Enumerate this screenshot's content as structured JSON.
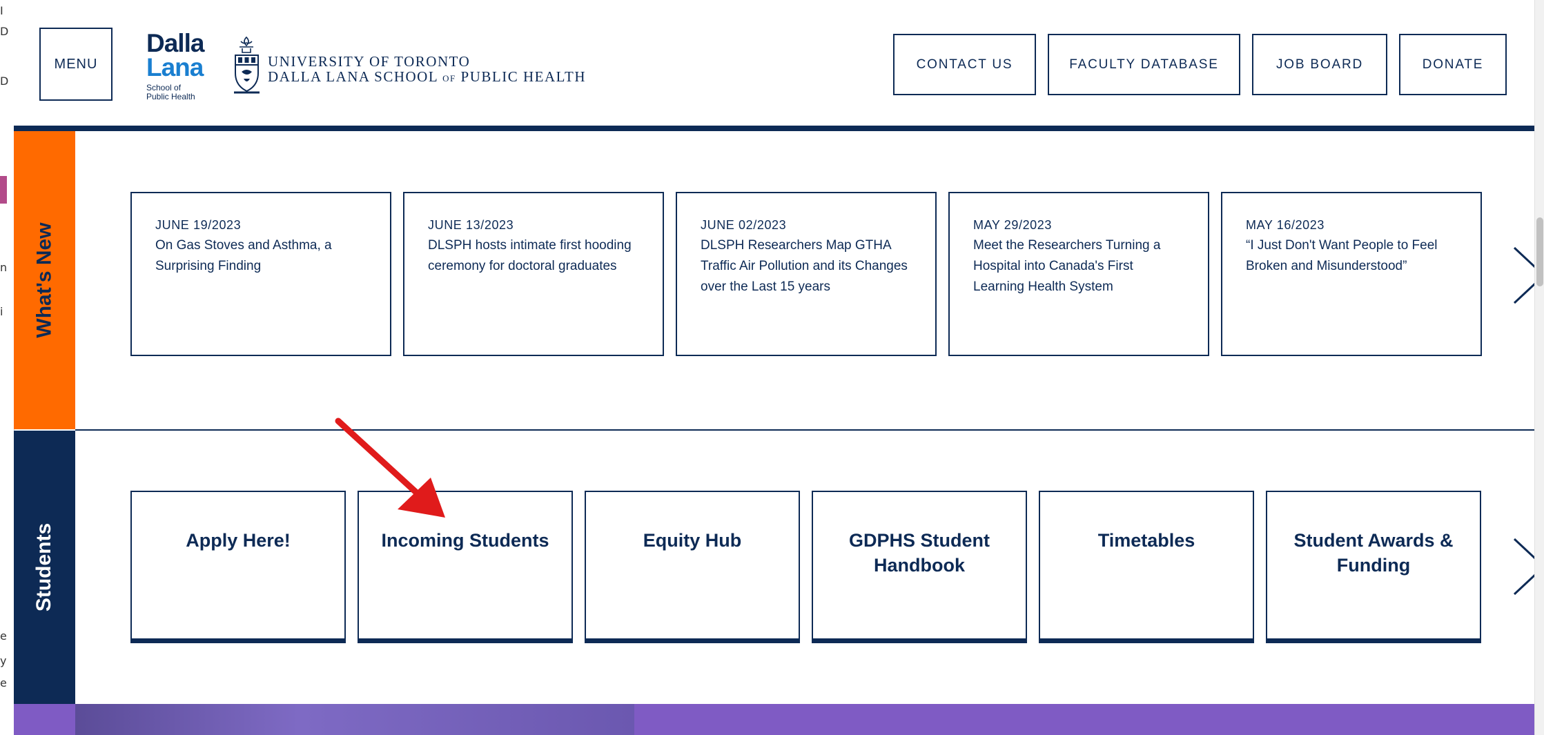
{
  "header": {
    "menu_label": "MENU",
    "logo": {
      "line1": "Dalla",
      "line2": "Lana",
      "line3": "School of",
      "line4": "Public Health"
    },
    "university": {
      "line1": "UNIVERSITY OF TORONTO",
      "line2_part1": "DALLA LANA SCHOOL ",
      "line2_of": "OF",
      "line2_part2": " PUBLIC HEALTH"
    },
    "buttons": [
      {
        "label": "CONTACT US"
      },
      {
        "label": "FACULTY DATABASE"
      },
      {
        "label": "JOB BOARD"
      },
      {
        "label": "DONATE"
      }
    ]
  },
  "sections": {
    "whats_new": {
      "tab_label": "What's New",
      "cards": [
        {
          "date": "JUNE 19/2023",
          "title": "On Gas Stoves and Asthma, a Surprising Finding"
        },
        {
          "date": "JUNE 13/2023",
          "title": "DLSPH hosts intimate first hooding ceremony for doctoral graduates"
        },
        {
          "date": "JUNE 02/2023",
          "title": "DLSPH Researchers Map GTHA Traffic Air Pollution and its Changes over the Last 15 years"
        },
        {
          "date": "MAY 29/2023",
          "title": "Meet the Researchers Turning a Hospital into Canada's First Learning Health System"
        },
        {
          "date": "MAY 16/2023",
          "title": "“I Just Don't Want People to Feel Broken and Misunderstood”"
        }
      ]
    },
    "students": {
      "tab_label": "Students",
      "cards": [
        {
          "label": "Apply Here!"
        },
        {
          "label": "Incoming Students"
        },
        {
          "label": "Equity Hub"
        },
        {
          "label": "GDPHS Student Handbook"
        },
        {
          "label": "Timetables"
        },
        {
          "label": "Student Awards & Funding"
        }
      ]
    }
  },
  "left_strip": {
    "fragments": [
      "I",
      "D",
      "D",
      "n",
      "i",
      "e",
      "y",
      "e"
    ]
  },
  "colors": {
    "navy": "#0d2a55",
    "orange": "#ff6a00",
    "purple": "#7f5bc4",
    "annotation_red": "#e01b1b",
    "logo_blue": "#1a7fd0"
  },
  "annotation": {
    "type": "arrow",
    "points_to": "Incoming Students"
  }
}
